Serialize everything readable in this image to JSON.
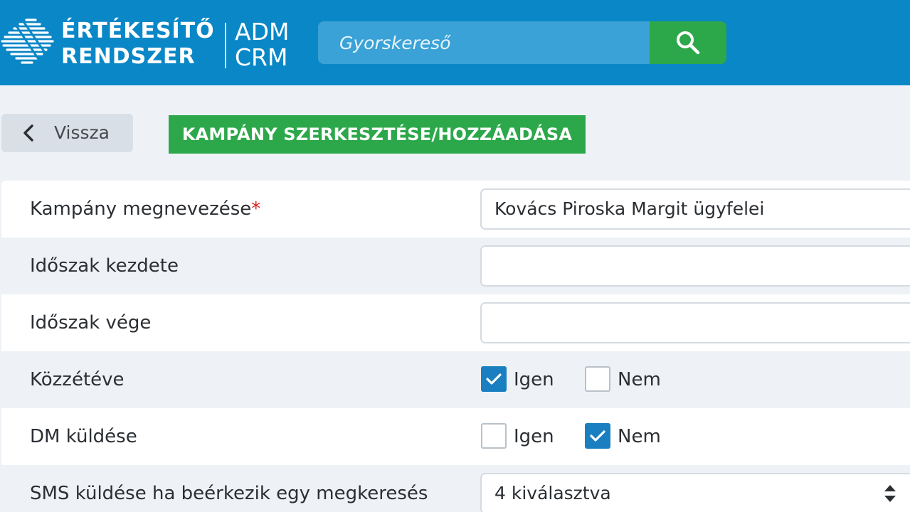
{
  "header": {
    "brand_line1": "ÉRTÉKESÍTŐ",
    "brand_line2": "RENDSZER",
    "product_line1": "ADM",
    "product_line2": "CRM",
    "search": {
      "placeholder": "Gyorskereső",
      "button_icon": "search-icon"
    }
  },
  "toolbar": {
    "back_label": "Vissza",
    "page_title": "KAMPÁNY SZERKESZTÉSE/HOZZÁADÁSA"
  },
  "form": {
    "campaign_name": {
      "label": "Kampány megnevezése",
      "required_mark": "*",
      "value": "Kovács Piroska Margit ügyfelei"
    },
    "period_start": {
      "label": "Időszak kezdete",
      "value": ""
    },
    "period_end": {
      "label": "Időszak vége",
      "value": ""
    },
    "published": {
      "label": "Közzétéve",
      "yes_label": "Igen",
      "no_label": "Nem",
      "selected": "Igen"
    },
    "dm_send": {
      "label": "DM küldése",
      "yes_label": "Igen",
      "no_label": "Nem",
      "selected": "Nem"
    },
    "sms_on_inquiry": {
      "label": "SMS küldése ha beérkezik egy megkeresés",
      "value": "4 kiválasztva"
    }
  },
  "colors": {
    "header_blue": "#0a87c6",
    "search_field": "#3aa2d6",
    "accent_green": "#2ca84a",
    "checkbox_blue": "#1a7fc0",
    "required_red": "#e02020"
  }
}
